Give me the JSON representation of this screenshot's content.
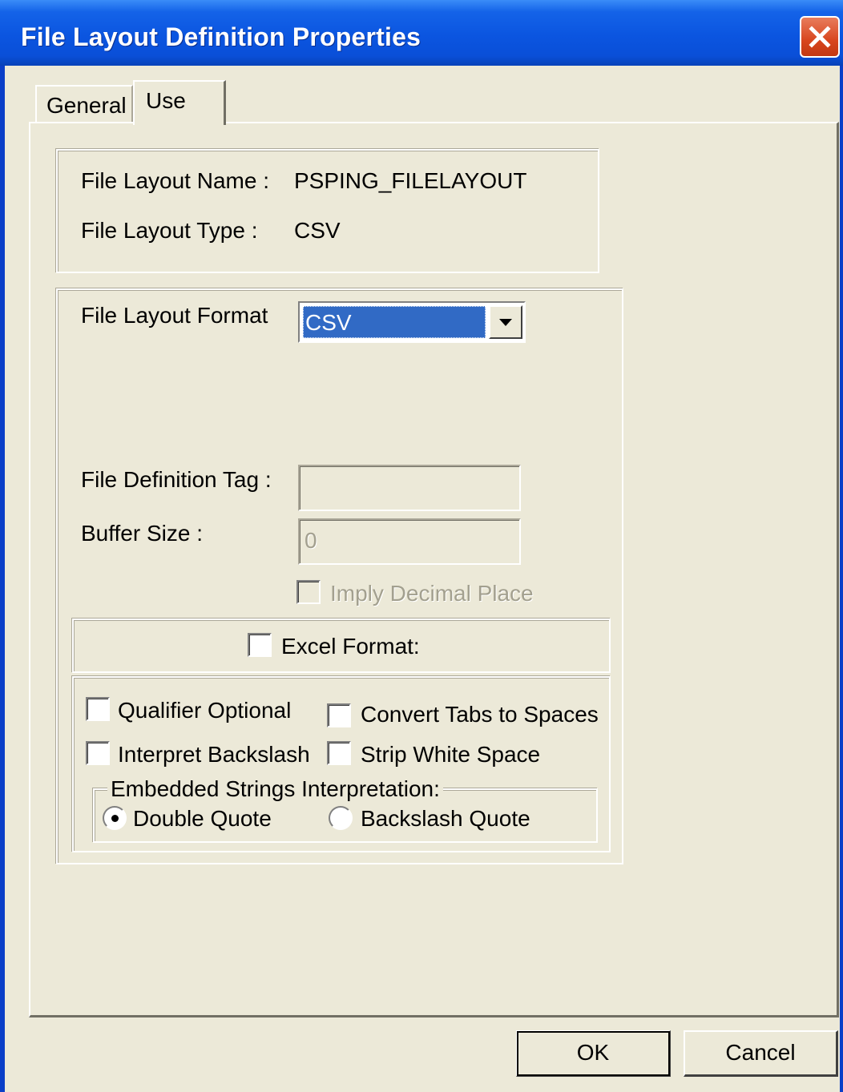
{
  "window": {
    "title": "File Layout Definition Properties",
    "close_icon": "close-icon"
  },
  "tabs": [
    {
      "label": "General",
      "active": false
    },
    {
      "label": "Use",
      "active": true
    }
  ],
  "info": {
    "name_label": "File Layout Name :",
    "name_value": "PSPING_FILELAYOUT",
    "type_label": "File Layout Type :",
    "type_value": "CSV"
  },
  "format": {
    "label": "File Layout Format",
    "selected": "CSV"
  },
  "fields": {
    "definition_tag_label": "File Definition Tag :",
    "definition_tag_value": "",
    "buffer_size_label": "Buffer Size :",
    "buffer_size_value": "0",
    "imply_decimal_label": "Imply Decimal Place",
    "imply_decimal_checked": false
  },
  "excel": {
    "label": "Excel Format:",
    "checked": false
  },
  "options": {
    "qualifier_optional": "Qualifier Optional",
    "convert_tabs": "Convert Tabs to Spaces",
    "interpret_backslash": "Interpret Backslash",
    "strip_white_space": "Strip White Space"
  },
  "embedded": {
    "legend": "Embedded Strings Interpretation:",
    "double_quote": "Double Quote",
    "backslash_quote": "Backslash Quote",
    "selected": "Double Quote"
  },
  "buttons": {
    "ok": "OK",
    "cancel": "Cancel"
  },
  "colors": {
    "titlebar": "#0a4fd8",
    "dialog_bg": "#ece9d8",
    "selection": "#316ac5",
    "close_button": "#d8461e"
  }
}
